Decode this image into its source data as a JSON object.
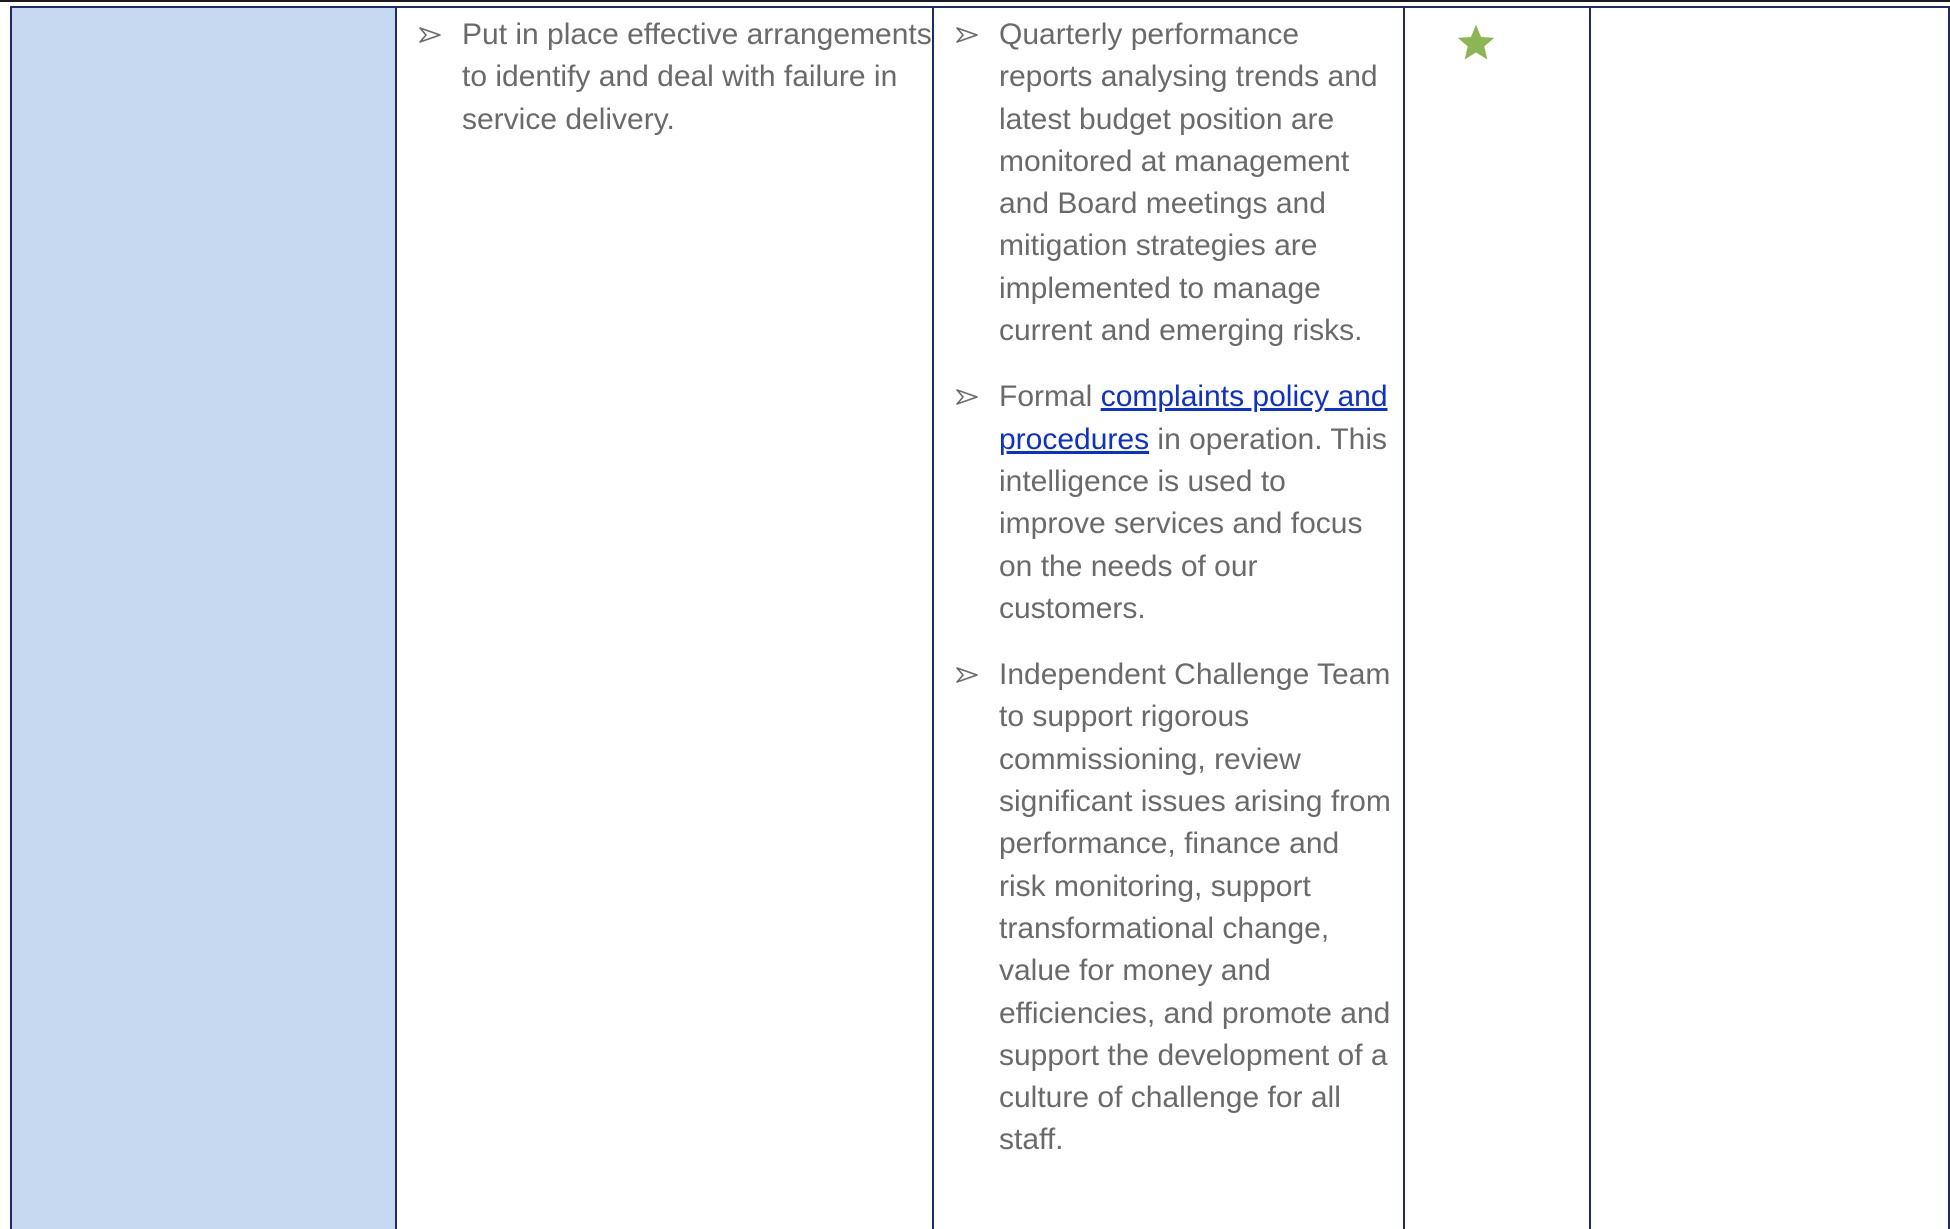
{
  "objective": {
    "items": [
      {
        "text": "Put in place effective arrangements to identify and deal with failure in service delivery."
      }
    ]
  },
  "evidence": {
    "items": [
      {
        "text": "Quarterly performance reports analysing trends and latest budget position are monitored at management and Board meetings and mitigation strategies are implemented to manage current and emerging risks."
      },
      {
        "prefix": "Formal ",
        "link": "complaints policy and procedures",
        "suffix": " in operation. This intelligence is used to improve services and focus on the needs of our customers."
      },
      {
        "text": "Independent Challenge Team to support rigorous commissioning, review significant issues arising from performance, finance and risk monitoring, support transformational change, value for money and efficiencies, and promote and support the development of a culture of challenge for all staff."
      }
    ]
  },
  "rating": {
    "icon": "star-icon",
    "color": "#8cb554"
  },
  "colors": {
    "shaded_cell": "#c6d9f1",
    "border": "#1f2a6b",
    "body_text": "#6a6a6a",
    "link": "#0b2fd6"
  }
}
